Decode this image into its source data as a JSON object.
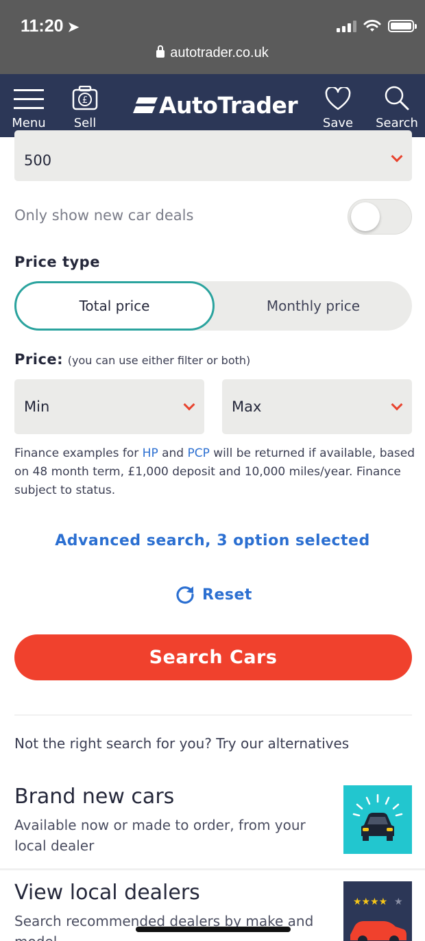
{
  "status_bar": {
    "time": "11:20",
    "url": "autotrader.co.uk"
  },
  "header": {
    "menu_label": "Menu",
    "sell_label": "Sell",
    "logo_text": "AutoTrader",
    "save_label": "Save",
    "search_label": "Search",
    "background": "#2c3757"
  },
  "form": {
    "distance_value": "500",
    "new_deals_label": "Only show new car deals",
    "new_deals_on": false,
    "price_type_label": "Price type",
    "price_type_options": [
      "Total price",
      "Monthly price"
    ],
    "price_type_selected": "Total price",
    "price_label": "Price:",
    "price_hint": "(you can use either filter or both)",
    "min_value": "Min",
    "max_value": "Max",
    "finance_text_1": "Finance examples for ",
    "finance_hp": "HP",
    "finance_and": " and ",
    "finance_pcp": "PCP",
    "finance_text_2": " will be returned if available, based on 48 month term, £1,000 deposit and 10,000 miles/year. Finance subject to status.",
    "advanced_search": "Advanced search, 3 option selected",
    "reset_label": "Reset",
    "search_button": "Search Cars",
    "accent": "#f0412d",
    "link_color": "#2b6fd1"
  },
  "alternatives": {
    "intro": "Not the right search for you? Try our alternatives",
    "items": [
      {
        "title": "Brand new cars",
        "description": "Available now or made to order, from your local dealer"
      },
      {
        "title": "View local dealers",
        "description": "Search recommended dealers by make and model"
      }
    ]
  }
}
